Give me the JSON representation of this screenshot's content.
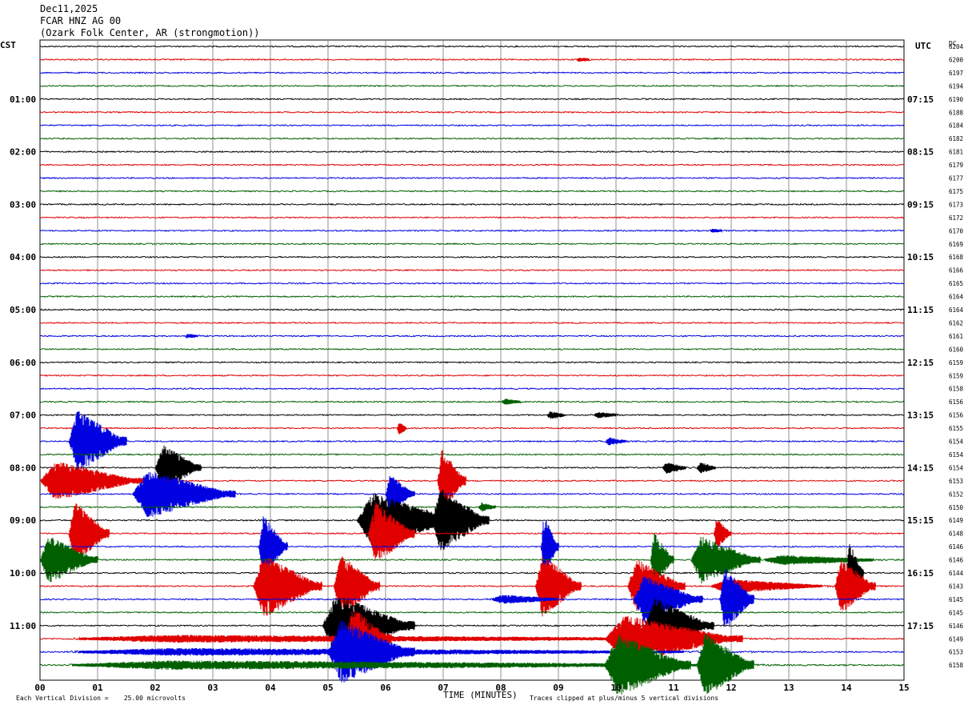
{
  "header": {
    "date": "Dec11,2025",
    "station": "FCAR HNZ AG 00",
    "location": "(Ozark Folk Center, AR (strongmotion))"
  },
  "left_timezone": "CST",
  "right_timezone": "UTC",
  "dc_label": "DC",
  "xaxis_title": "TIME (MINUTES)",
  "footer": {
    "scale": "Each Vertical Division =    25.00 microvolts",
    "clip": "Traces clipped at plus/minus 5 vertical divisions"
  },
  "colors": {
    "trace_cycle": [
      "#000000",
      "#e00000",
      "#0000e0",
      "#006000"
    ],
    "grid": "#777777"
  },
  "chart_data": {
    "type": "line",
    "title": "",
    "xlabel": "TIME (MINUTES)",
    "xlim": [
      0,
      15
    ],
    "x_ticks": [
      "00",
      "01",
      "02",
      "03",
      "04",
      "05",
      "06",
      "07",
      "08",
      "09",
      "10",
      "11",
      "12",
      "13",
      "14",
      "15"
    ],
    "rows": 48,
    "row_minutes": 15,
    "left_ticks": [
      "01:00",
      "02:00",
      "03:00",
      "04:00",
      "05:00",
      "06:00",
      "07:00",
      "08:00",
      "09:00",
      "10:00",
      "11:00"
    ],
    "right_ticks": [
      "07:15",
      "08:15",
      "09:15",
      "10:15",
      "11:15",
      "12:15",
      "13:15",
      "14:15",
      "15:15",
      "16:15",
      "17:15"
    ],
    "dc_values": [
      "6204",
      "6200",
      "6197",
      "6194",
      "6190",
      "6188",
      "6184",
      "6182",
      "6181",
      "6179",
      "6177",
      "6175",
      "6173",
      "6172",
      "6170",
      "6169",
      "6168",
      "6166",
      "6165",
      "6164",
      "6164",
      "6162",
      "6161",
      "6160",
      "6159",
      "6159",
      "6158",
      "6156",
      "6156",
      "6155",
      "6154",
      "6154",
      "6154",
      "6153",
      "6152",
      "6150",
      "6149",
      "6148",
      "6146",
      "6146",
      "6144",
      "6143",
      "6145",
      "6145",
      "6146",
      "6149",
      "6153",
      "6158"
    ],
    "events": [
      {
        "row": 1,
        "minute": 9.3,
        "dur": 0.4,
        "amp": 3,
        "fill": 0.5
      },
      {
        "row": 14,
        "minute": 11.6,
        "dur": 0.5,
        "amp": 2.5,
        "fill": 0.5
      },
      {
        "row": 22,
        "minute": 2.5,
        "dur": 0.4,
        "amp": 3,
        "fill": 0.5
      },
      {
        "row": 27,
        "minute": 8.0,
        "dur": 0.5,
        "amp": 4,
        "fill": 0.5
      },
      {
        "row": 28,
        "minute": 8.8,
        "dur": 0.4,
        "amp": 5,
        "fill": 0.7
      },
      {
        "row": 28,
        "minute": 9.6,
        "dur": 0.6,
        "amp": 4,
        "fill": 0.6
      },
      {
        "row": 29,
        "minute": 6.2,
        "dur": 0.2,
        "amp": 8,
        "fill": 0.8
      },
      {
        "row": 30,
        "minute": 9.8,
        "dur": 0.5,
        "amp": 5,
        "fill": 0.5
      },
      {
        "row": 32,
        "minute": 10.8,
        "dur": 0.5,
        "amp": 7,
        "fill": 0.7
      },
      {
        "row": 32,
        "minute": 11.4,
        "dur": 0.4,
        "amp": 7,
        "fill": 0.7
      },
      {
        "row": 30,
        "minute": 0.5,
        "dur": 1.0,
        "amp": 40,
        "fill": 1.0
      },
      {
        "row": 33,
        "minute": 0.0,
        "dur": 1.8,
        "amp": 25,
        "fill": 1.0
      },
      {
        "row": 32,
        "minute": 2.0,
        "dur": 0.8,
        "amp": 30,
        "fill": 1.0
      },
      {
        "row": 34,
        "minute": 1.6,
        "dur": 1.8,
        "amp": 30,
        "fill": 1.0
      },
      {
        "row": 35,
        "minute": 7.6,
        "dur": 0.4,
        "amp": 6,
        "fill": 0.5
      },
      {
        "row": 34,
        "minute": 6.0,
        "dur": 0.5,
        "amp": 25,
        "fill": 1.0
      },
      {
        "row": 36,
        "minute": 5.5,
        "dur": 1.8,
        "amp": 35,
        "fill": 1.0
      },
      {
        "row": 33,
        "minute": 6.9,
        "dur": 0.5,
        "amp": 40,
        "fill": 1.0
      },
      {
        "row": 36,
        "minute": 6.8,
        "dur": 1.0,
        "amp": 40,
        "fill": 1.0
      },
      {
        "row": 37,
        "minute": 5.7,
        "dur": 0.8,
        "amp": 40,
        "fill": 1.0
      },
      {
        "row": 37,
        "minute": 0.5,
        "dur": 0.7,
        "amp": 40,
        "fill": 1.0
      },
      {
        "row": 39,
        "minute": 0.0,
        "dur": 1.0,
        "amp": 30,
        "fill": 1.0
      },
      {
        "row": 37,
        "minute": 11.7,
        "dur": 0.3,
        "amp": 20,
        "fill": 0.9
      },
      {
        "row": 39,
        "minute": 11.3,
        "dur": 1.2,
        "amp": 30,
        "fill": 1.0
      },
      {
        "row": 39,
        "minute": 12.5,
        "dur": 2.5,
        "amp": 6,
        "fill": 0.7
      },
      {
        "row": 38,
        "minute": 3.8,
        "dur": 0.5,
        "amp": 40,
        "fill": 1.0
      },
      {
        "row": 41,
        "minute": 3.7,
        "dur": 1.2,
        "amp": 40,
        "fill": 1.0
      },
      {
        "row": 38,
        "minute": 8.7,
        "dur": 0.3,
        "amp": 40,
        "fill": 1.0
      },
      {
        "row": 41,
        "minute": 8.6,
        "dur": 0.8,
        "amp": 40,
        "fill": 1.0
      },
      {
        "row": 39,
        "minute": 10.6,
        "dur": 0.4,
        "amp": 35,
        "fill": 1.0
      },
      {
        "row": 41,
        "minute": 10.2,
        "dur": 1.0,
        "amp": 35,
        "fill": 1.0
      },
      {
        "row": 41,
        "minute": 11.6,
        "dur": 2.3,
        "amp": 9,
        "fill": 0.95
      },
      {
        "row": 40,
        "minute": 14.0,
        "dur": 0.3,
        "amp": 40,
        "fill": 1.0
      },
      {
        "row": 41,
        "minute": 13.8,
        "dur": 0.7,
        "amp": 35,
        "fill": 1.0
      },
      {
        "row": 42,
        "minute": 7.8,
        "dur": 1.5,
        "amp": 6,
        "fill": 0.5
      },
      {
        "row": 42,
        "minute": 10.3,
        "dur": 1.2,
        "amp": 30,
        "fill": 1.0
      },
      {
        "row": 42,
        "minute": 11.8,
        "dur": 0.6,
        "amp": 40,
        "fill": 1.0
      },
      {
        "row": 41,
        "minute": 5.1,
        "dur": 0.8,
        "amp": 40,
        "fill": 1.0
      },
      {
        "row": 44,
        "minute": 4.9,
        "dur": 1.6,
        "amp": 40,
        "fill": 1.0
      },
      {
        "row": 45,
        "minute": 5.3,
        "dur": 0.8,
        "amp": 40,
        "fill": 1.0
      },
      {
        "row": 45,
        "minute": 0.0,
        "dur": 15.0,
        "amp": 5,
        "fill": 0.5
      },
      {
        "row": 44,
        "minute": 10.5,
        "dur": 1.2,
        "amp": 35,
        "fill": 1.0
      },
      {
        "row": 45,
        "minute": 9.8,
        "dur": 2.4,
        "amp": 30,
        "fill": 1.0
      },
      {
        "row": 46,
        "minute": 0.0,
        "dur": 15.0,
        "amp": 5,
        "fill": 0.6
      },
      {
        "row": 47,
        "minute": 0.0,
        "dur": 15.0,
        "amp": 6,
        "fill": 0.6
      },
      {
        "row": 47,
        "minute": 9.8,
        "dur": 1.5,
        "amp": 40,
        "fill": 1.0
      },
      {
        "row": 47,
        "minute": 11.4,
        "dur": 1.0,
        "amp": 40,
        "fill": 1.0
      },
      {
        "row": 46,
        "minute": 5.0,
        "dur": 1.5,
        "amp": 40,
        "fill": 1.0
      }
    ]
  }
}
